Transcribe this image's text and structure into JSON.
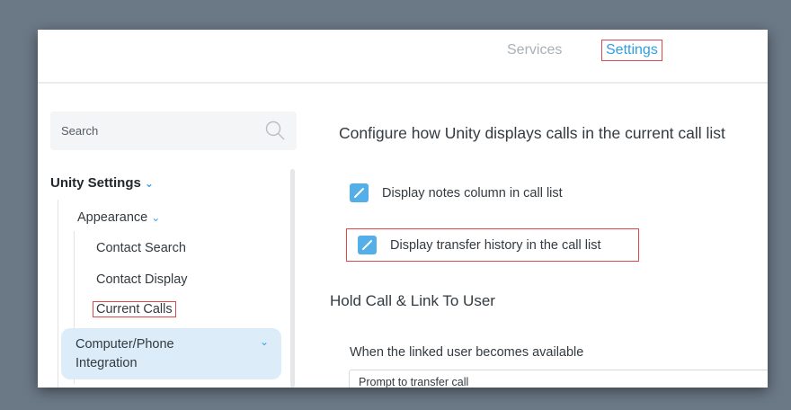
{
  "header": {
    "tabs": [
      {
        "label": "Services"
      },
      {
        "label": "Settings"
      }
    ]
  },
  "sidebar": {
    "search_label": "Search",
    "tree": {
      "unity_settings": "Unity Settings",
      "appearance": "Appearance",
      "contact_search": "Contact Search",
      "contact_display": "Contact Display",
      "current_calls": "Current Calls",
      "computer_phone_integration": "Computer/Phone Integration"
    }
  },
  "main": {
    "heading": "Configure how Unity displays calls in the current call list",
    "options": [
      {
        "label": "Display notes column in call list",
        "checked": true
      },
      {
        "label": "Display transfer history in the call list",
        "checked": true
      }
    ],
    "hold_section_title": "Hold Call & Link To User",
    "linked_user_label": "When the linked user becomes available",
    "linked_user_select_value": "Prompt to transfer call"
  },
  "colors": {
    "accent": "#2f9fe5",
    "checkbox": "#54aee8",
    "highlight_border": "#e0474c",
    "selected_item_bg": "#dcedf9"
  }
}
